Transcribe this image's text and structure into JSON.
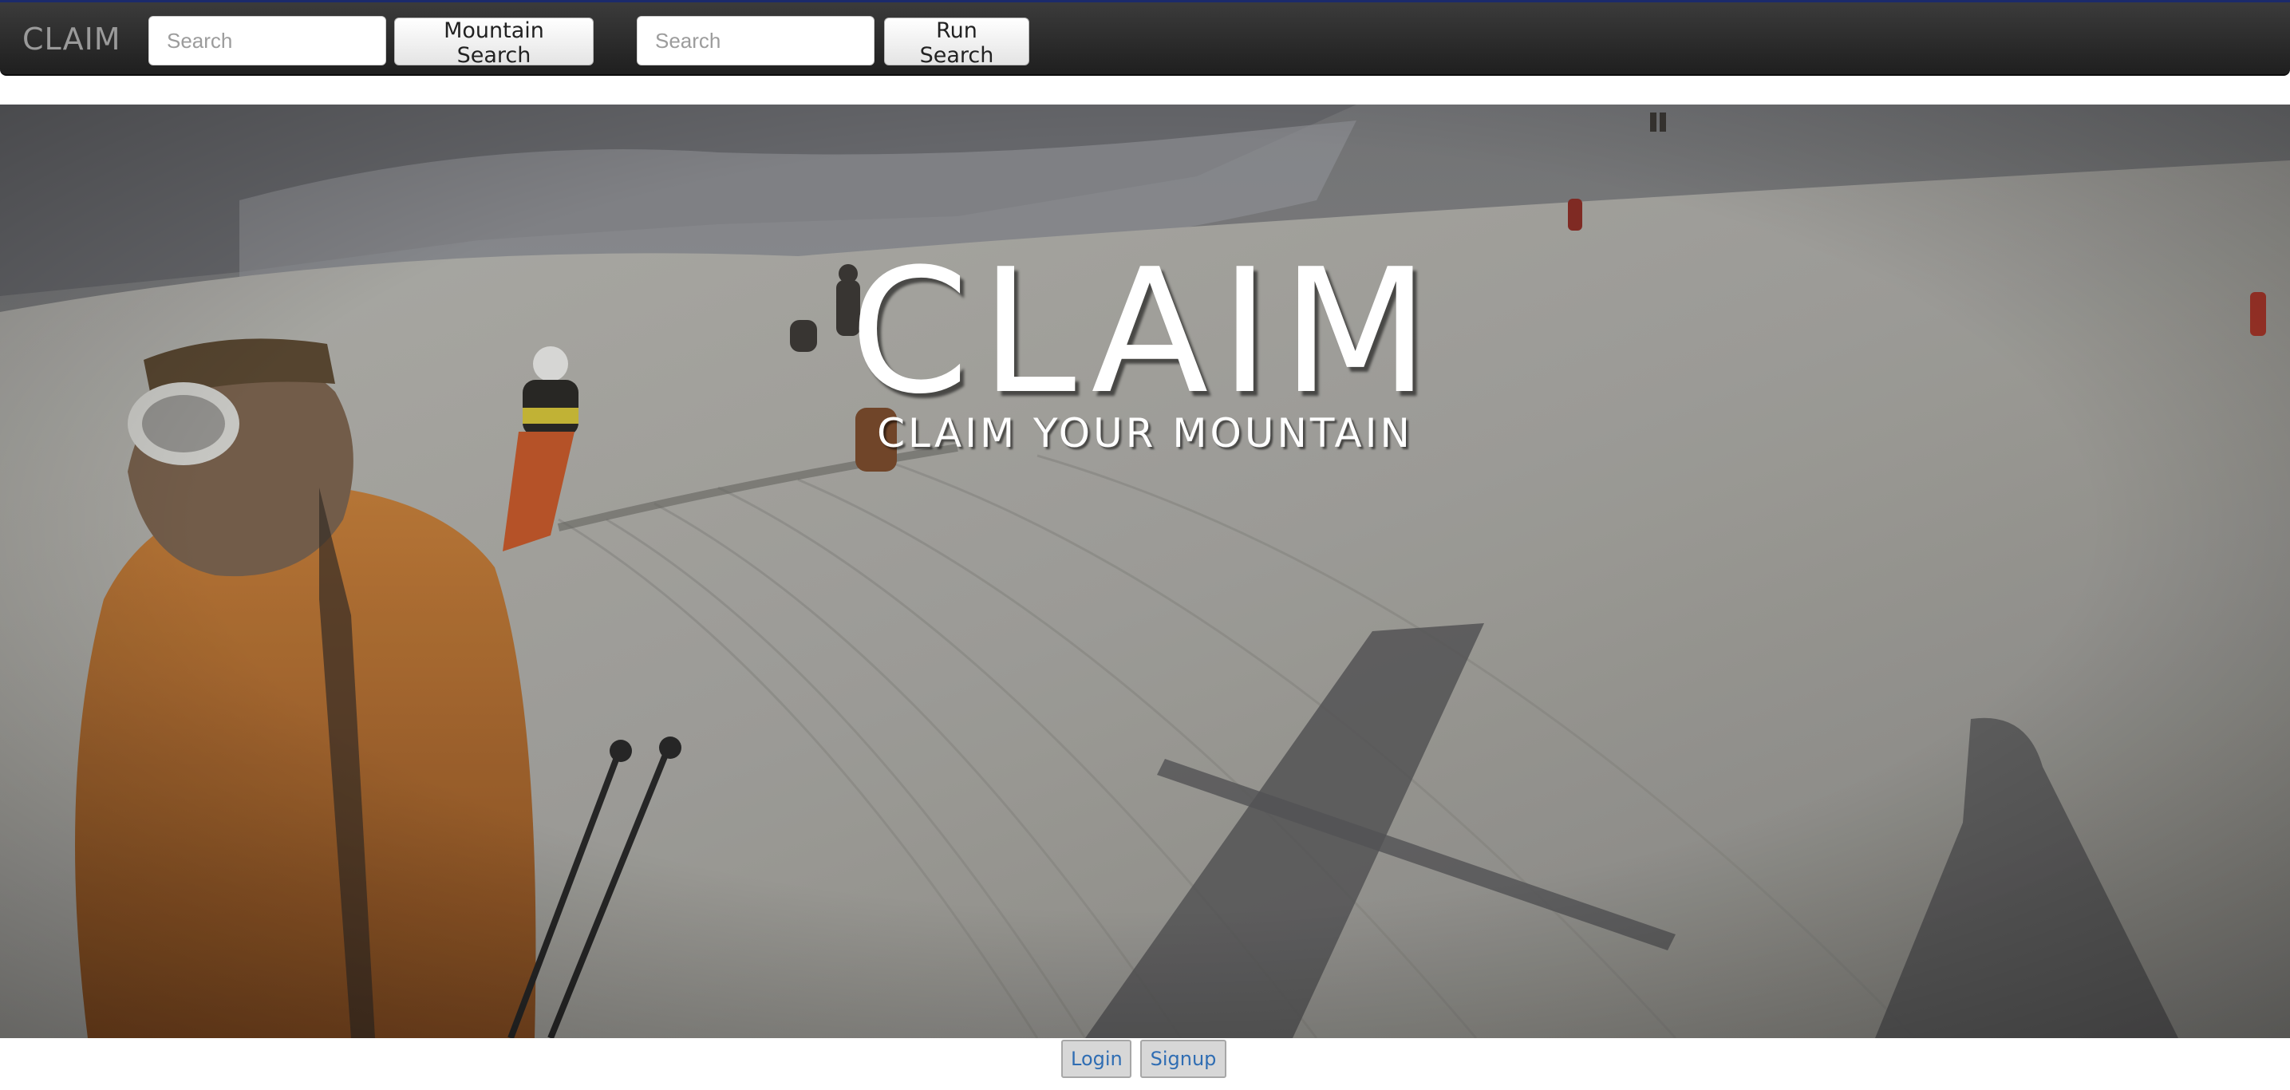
{
  "navbar": {
    "brand": "CLAIM",
    "mountain_search": {
      "placeholder": "Search",
      "button_label": "Mountain Search"
    },
    "run_search": {
      "placeholder": "Search",
      "button_label": "Run Search"
    }
  },
  "hero": {
    "title": "CLAIM",
    "subtitle": "CLAIM YOUR MOUNTAIN",
    "background_image": "skier-selfie-on-snowy-slope"
  },
  "auth": {
    "login_label": "Login",
    "signup_label": "Signup"
  },
  "colors": {
    "navbar_bg": "#2b2b2b",
    "navbar_top_border": "#1b2a6b",
    "brand_text": "#9a9a9a",
    "link_text": "#2f6db3"
  }
}
